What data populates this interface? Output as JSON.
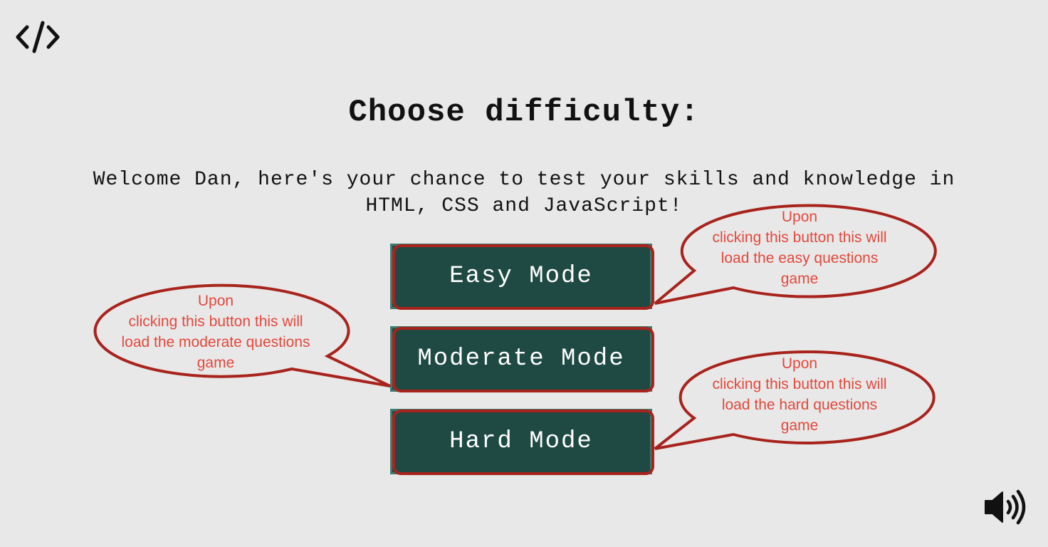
{
  "logo": {
    "icon": "code-brackets-icon"
  },
  "title": "Choose difficulty:",
  "welcome": {
    "line1": "Welcome Dan, here's your chance to test your skills and knowledge in",
    "line2": "HTML, CSS and JavaScript!"
  },
  "modes": {
    "easy_label": "Easy Mode",
    "moderate_label": "Moderate Mode",
    "hard_label": "Hard Mode"
  },
  "annotations": {
    "easy": [
      "Upon",
      "clicking this button this will",
      "load the easy questions",
      "game"
    ],
    "moderate": [
      "Upon",
      "clicking this button this will",
      "load the moderate questions",
      "game"
    ],
    "hard": [
      "Upon",
      "clicking this button this will",
      "load the hard questions",
      "game"
    ]
  },
  "sound": {
    "icon": "volume-up-icon"
  },
  "colors": {
    "background": "#e8e8e8",
    "button_fill": "#1f4a43",
    "button_text": "#ffffff",
    "annotation_outline": "#a8231c",
    "annotation_text": "#e3483c"
  }
}
